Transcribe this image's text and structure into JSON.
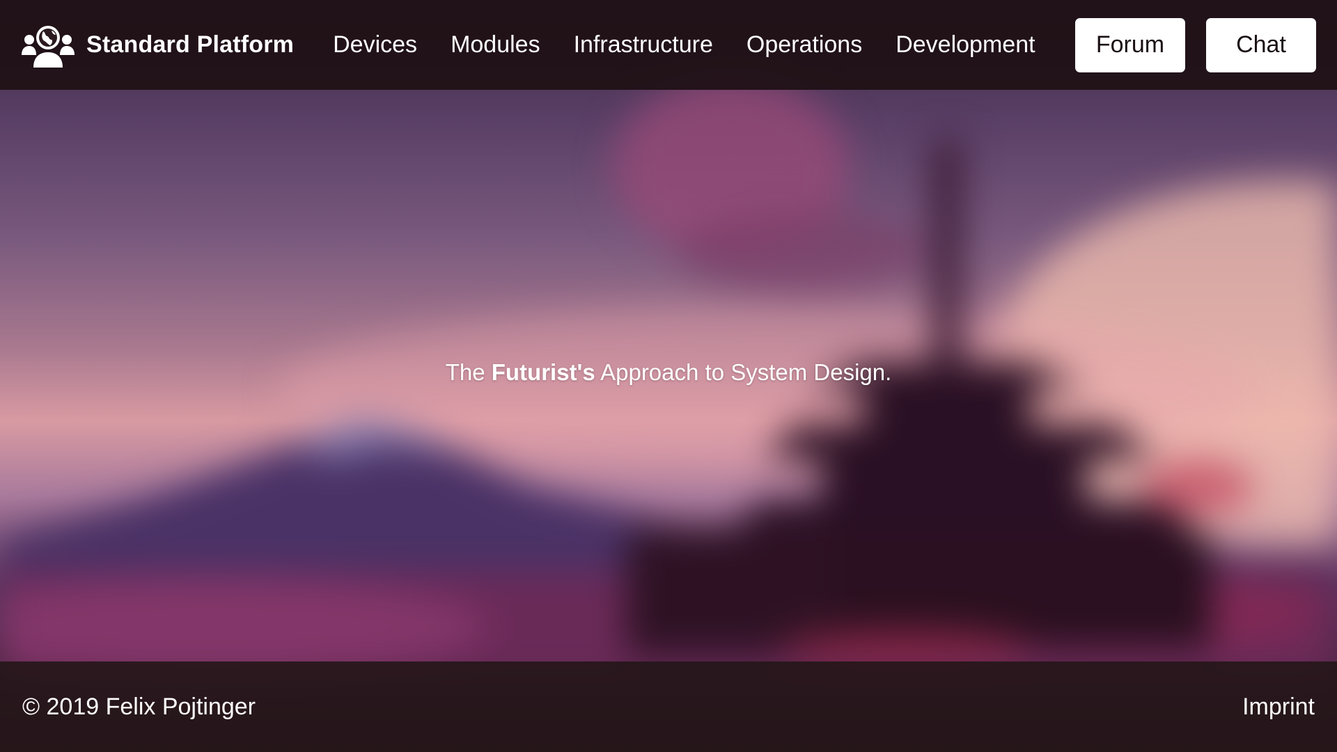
{
  "header": {
    "brand": {
      "icon": "community-globe-icon",
      "name": "Standard Platform"
    },
    "nav": [
      {
        "label": "Devices"
      },
      {
        "label": "Modules"
      },
      {
        "label": "Infrastructure"
      },
      {
        "label": "Operations"
      },
      {
        "label": "Development"
      }
    ],
    "actions": {
      "forum_label": "Forum",
      "chat_label": "Chat"
    }
  },
  "hero": {
    "tagline_prefix": "The ",
    "tagline_bold": "Futurist's",
    "tagline_suffix": " Approach to System Design."
  },
  "footer": {
    "copyright": "© 2019 Felix Pojtinger",
    "imprint_label": "Imprint"
  },
  "colors": {
    "header_bg": "#1e1014",
    "button_bg": "#ffffff",
    "button_text": "#1a1014",
    "text": "#ffffff"
  }
}
